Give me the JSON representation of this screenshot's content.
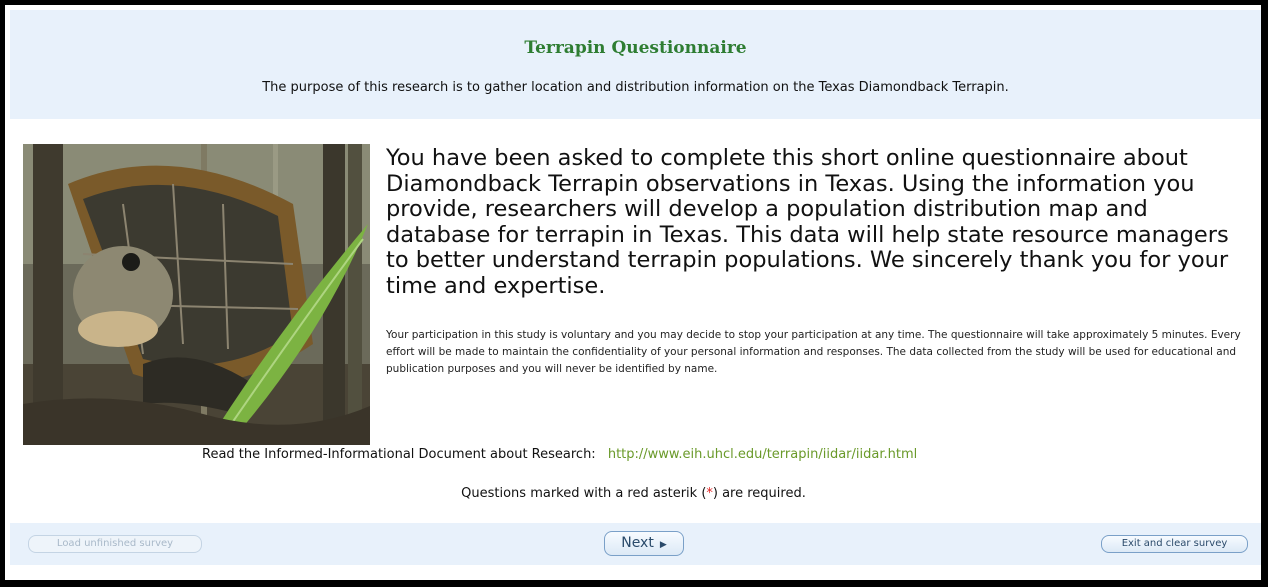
{
  "header": {
    "title": "Terrapin Questionnaire",
    "subtitle": "The purpose of this research is to gather location and distribution information on the Texas Diamondback Terrapin."
  },
  "intro": {
    "main_text": "You have been asked to complete this short online questionnaire about Diamondback Terrapin observations in Texas. Using the information you provide, researchers will develop a population distribution map and database for terrapin in Texas. This data will help state resource managers to better understand terrapin populations. We sincerely thank you for your time and expertise.",
    "fine_print": "Your participation in this study is voluntary and you may decide to stop your participation at any time. The questionnaire will take approximately 5 minutes. Every effort will be made to maintain the confidentiality of your personal information and responses. The data collected from the study will be used for educational and publication purposes and you will never be identified by name."
  },
  "document": {
    "label": "Read the Informed-Informational Document about Research:",
    "link": "http://www.eih.uhcl.edu/terrapin/iidar/iidar.html"
  },
  "required_note": {
    "before": "Questions marked with a red asterik (",
    "star": "*",
    "after": ") are required."
  },
  "nav": {
    "load_label": "Load unfinished survey",
    "next_label": "Next",
    "next_icon": "caret-right-icon",
    "exit_label": "Exit and clear survey"
  },
  "colors": {
    "title_green": "#2e7d32",
    "link_green": "#6a9a2a",
    "required_red": "#e02020",
    "header_bg": "#e8f1fb"
  }
}
